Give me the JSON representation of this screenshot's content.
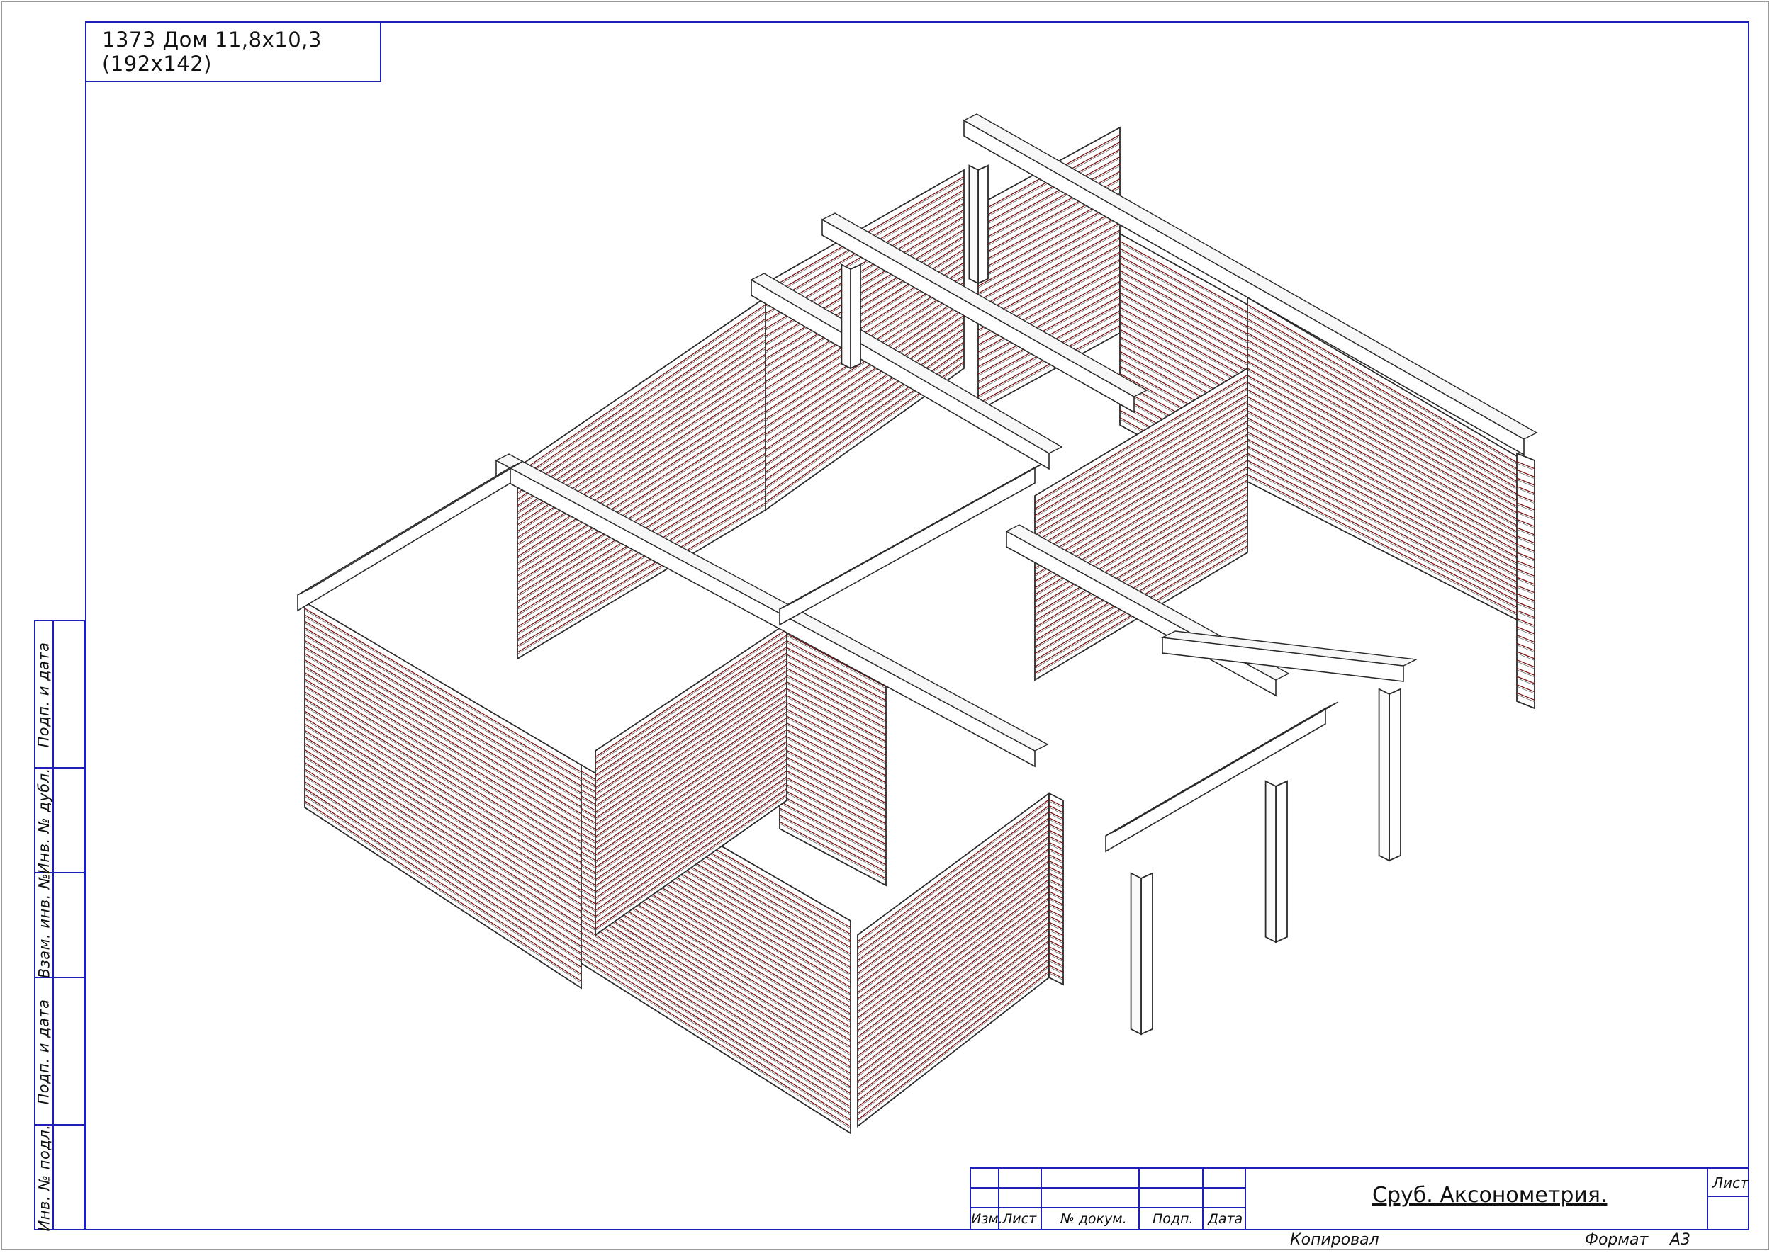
{
  "sheet": {
    "title_tag": "1373 Дом 11,8x10,3 (192x142)"
  },
  "side_strip": [
    "Подп. и дата",
    "Инв. № дубл.",
    "Взам. инв. №",
    "Подп. и дата",
    "Инв. № подл."
  ],
  "stamp": {
    "col_labels": [
      "Изм.",
      "Лист",
      "№ докум.",
      "Подп.",
      "Дата"
    ],
    "title": "Сруб. Аксонометрия.",
    "sheet_label": "Лист"
  },
  "footer": {
    "copied": "Копировал",
    "format_label": "Формат",
    "format_value": "А3"
  },
  "colors": {
    "frame": "#1d1fb8",
    "log_lines": "#7a1414",
    "outline": "#2a2a2a"
  }
}
